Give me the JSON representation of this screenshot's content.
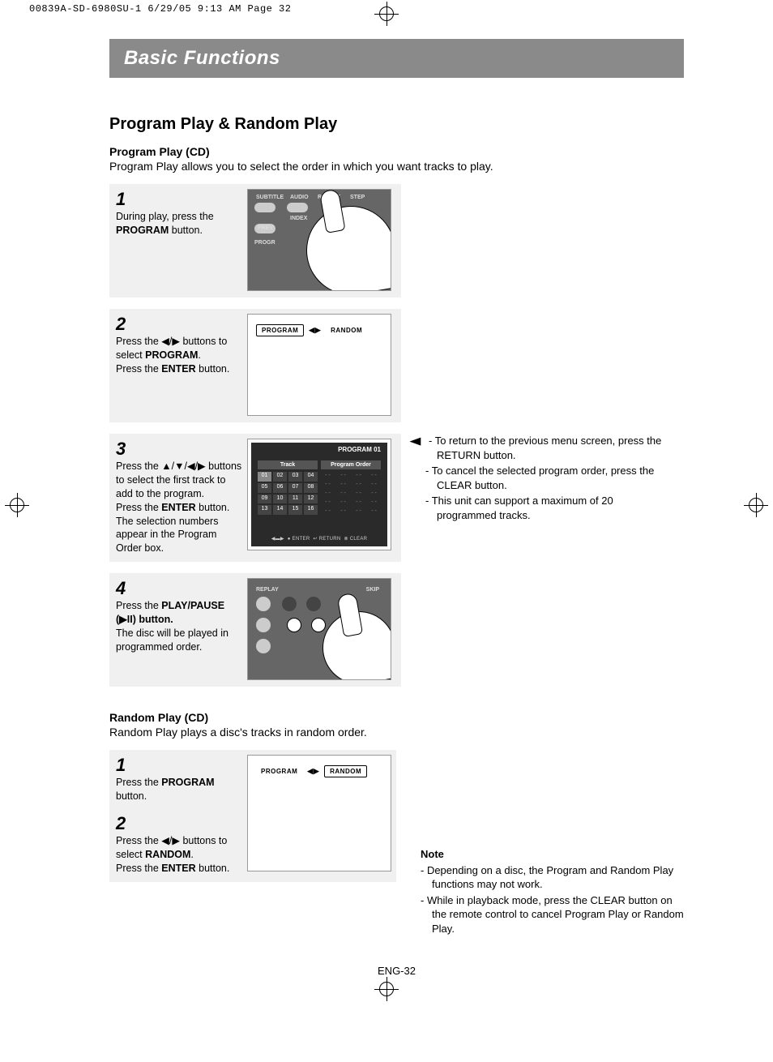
{
  "meta_line": "00839A-SD-6980SU-1  6/29/05  9:13 AM  Page 32",
  "banner": "Basic Functions",
  "heading": "Program Play & Random Play",
  "program": {
    "title": "Program Play (CD)",
    "desc": "Program Play allows you to select the order in which you want tracks to play.",
    "steps": {
      "s1": {
        "num": "1",
        "l1": "During play, press the",
        "b1": "PROGRAM",
        "l2": " button."
      },
      "s2": {
        "num": "2",
        "l1": "Press the ",
        "sym": "◀/▶",
        "l2": " buttons to select ",
        "b1": "PROGRAM",
        "l3": ".",
        "l4": "Press the ",
        "b2": "ENTER",
        "l5": " button."
      },
      "s3": {
        "num": "3",
        "l1": "Press the ",
        "sym": "▲/▼/◀/▶",
        "l2": " buttons to select the first track to add to the program.",
        "l3": "Press the ",
        "b1": "ENTER",
        "l4": " button.",
        "l5": "The selection numbers appear in the Program Order box."
      },
      "s4": {
        "num": "4",
        "l1": "Press the ",
        "b1": "PLAY/PAUSE",
        "l2": "(",
        "sym": "▶II",
        "l3": ") button.",
        "l4": "The disc will be played in programmed order."
      }
    }
  },
  "screen2": {
    "program": "PROGRAM",
    "random": "RANDOM"
  },
  "screen3": {
    "title": "PROGRAM 01",
    "h1": "Track",
    "h2": "Program Order",
    "tracks": [
      "01",
      "02",
      "03",
      "04",
      "05",
      "06",
      "07",
      "08",
      "09",
      "10",
      "11",
      "12",
      "13",
      "14",
      "15",
      "16"
    ],
    "dash": "- -",
    "footer_enter": "ENTER",
    "footer_return": "RETURN",
    "footer_clear": "CLEAR"
  },
  "side": {
    "n1": "- To return to the previous menu screen, press the RETURN button.",
    "n2": "- To cancel the selected program order, press the CLEAR button.",
    "n3": "- This unit can support a maximum of 20 programmed tracks."
  },
  "random": {
    "title": "Random Play (CD)",
    "desc": "Random Play plays a disc's tracks in random order.",
    "s1": {
      "num": "1",
      "l1": "Press the ",
      "b1": "PROGRAM",
      "l2": " button."
    },
    "s2": {
      "num": "2",
      "l1": "Press the ",
      "sym": "◀/▶",
      "l2": " buttons to select ",
      "b1": "RANDOM",
      "l3": ".",
      "l4": "Press the ",
      "b2": "ENTER",
      "l5": " button."
    }
  },
  "note": {
    "title": "Note",
    "n1": "-  Depending on a disc, the Program and Random Play functions may not work.",
    "n2": "-  While in playback mode, press the CLEAR button on the remote control to cancel Program Play or Random Play."
  },
  "remote_labels": {
    "subtitle": "SUBTITLE",
    "audio": "AUDIO",
    "repeat": "REPEAT",
    "step": "STEP",
    "index": "INDEX",
    "prev": "PREV",
    "progr": "PROGR",
    "replay": "REPLAY",
    "skip": "SKIP"
  },
  "page_num": "ENG-32"
}
